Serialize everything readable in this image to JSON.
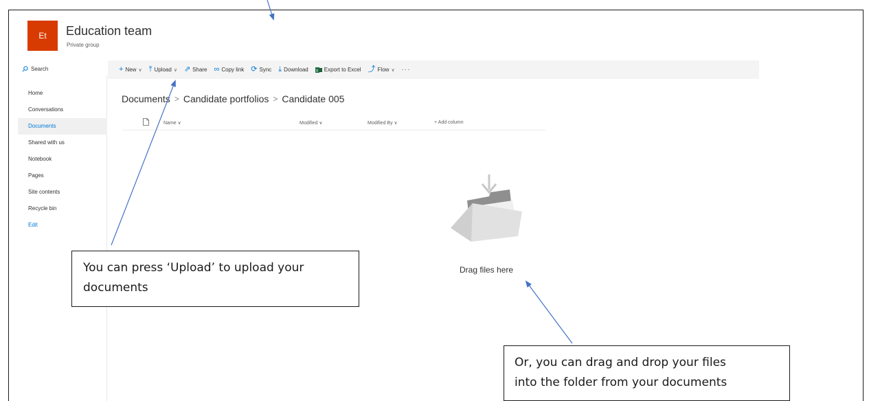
{
  "group": {
    "logo_text": "Et",
    "title": "Education team",
    "subtitle": "Private group"
  },
  "sidebar": {
    "search_label": "Search",
    "items": [
      {
        "label": "Home"
      },
      {
        "label": "Conversations"
      },
      {
        "label": "Documents",
        "active": true
      },
      {
        "label": "Shared with us"
      },
      {
        "label": "Notebook"
      },
      {
        "label": "Pages"
      },
      {
        "label": "Site contents"
      },
      {
        "label": "Recycle bin"
      },
      {
        "label": "Edit"
      }
    ]
  },
  "toolbar": {
    "new_label": "New",
    "upload_label": "Upload",
    "share_label": "Share",
    "copylink_label": "Copy link",
    "sync_label": "Sync",
    "download_label": "Download",
    "export_label": "Export to Excel",
    "flow_label": "Flow",
    "more_label": "···",
    "chevron_glyph": "∨"
  },
  "breadcrumb": {
    "items": [
      "Documents",
      "Candidate portfolios",
      "Candidate 005"
    ],
    "separator": ">"
  },
  "list": {
    "columns": {
      "name": "Name ∨",
      "modified": "Modified ∨",
      "modified_by": "Modified By ∨",
      "add_column": "+ Add column"
    }
  },
  "empty_state": {
    "text": "Drag files here"
  },
  "callouts": {
    "upload_line1": "You can press ‘Upload’ to upload your",
    "upload_line2": "documents",
    "drag_line1": "Or, you can drag and drop your files",
    "drag_line2": "into the folder from your documents"
  },
  "colors": {
    "brand_logo": "#d83b01",
    "accent": "#0078d4",
    "arrow": "#4472c4"
  }
}
